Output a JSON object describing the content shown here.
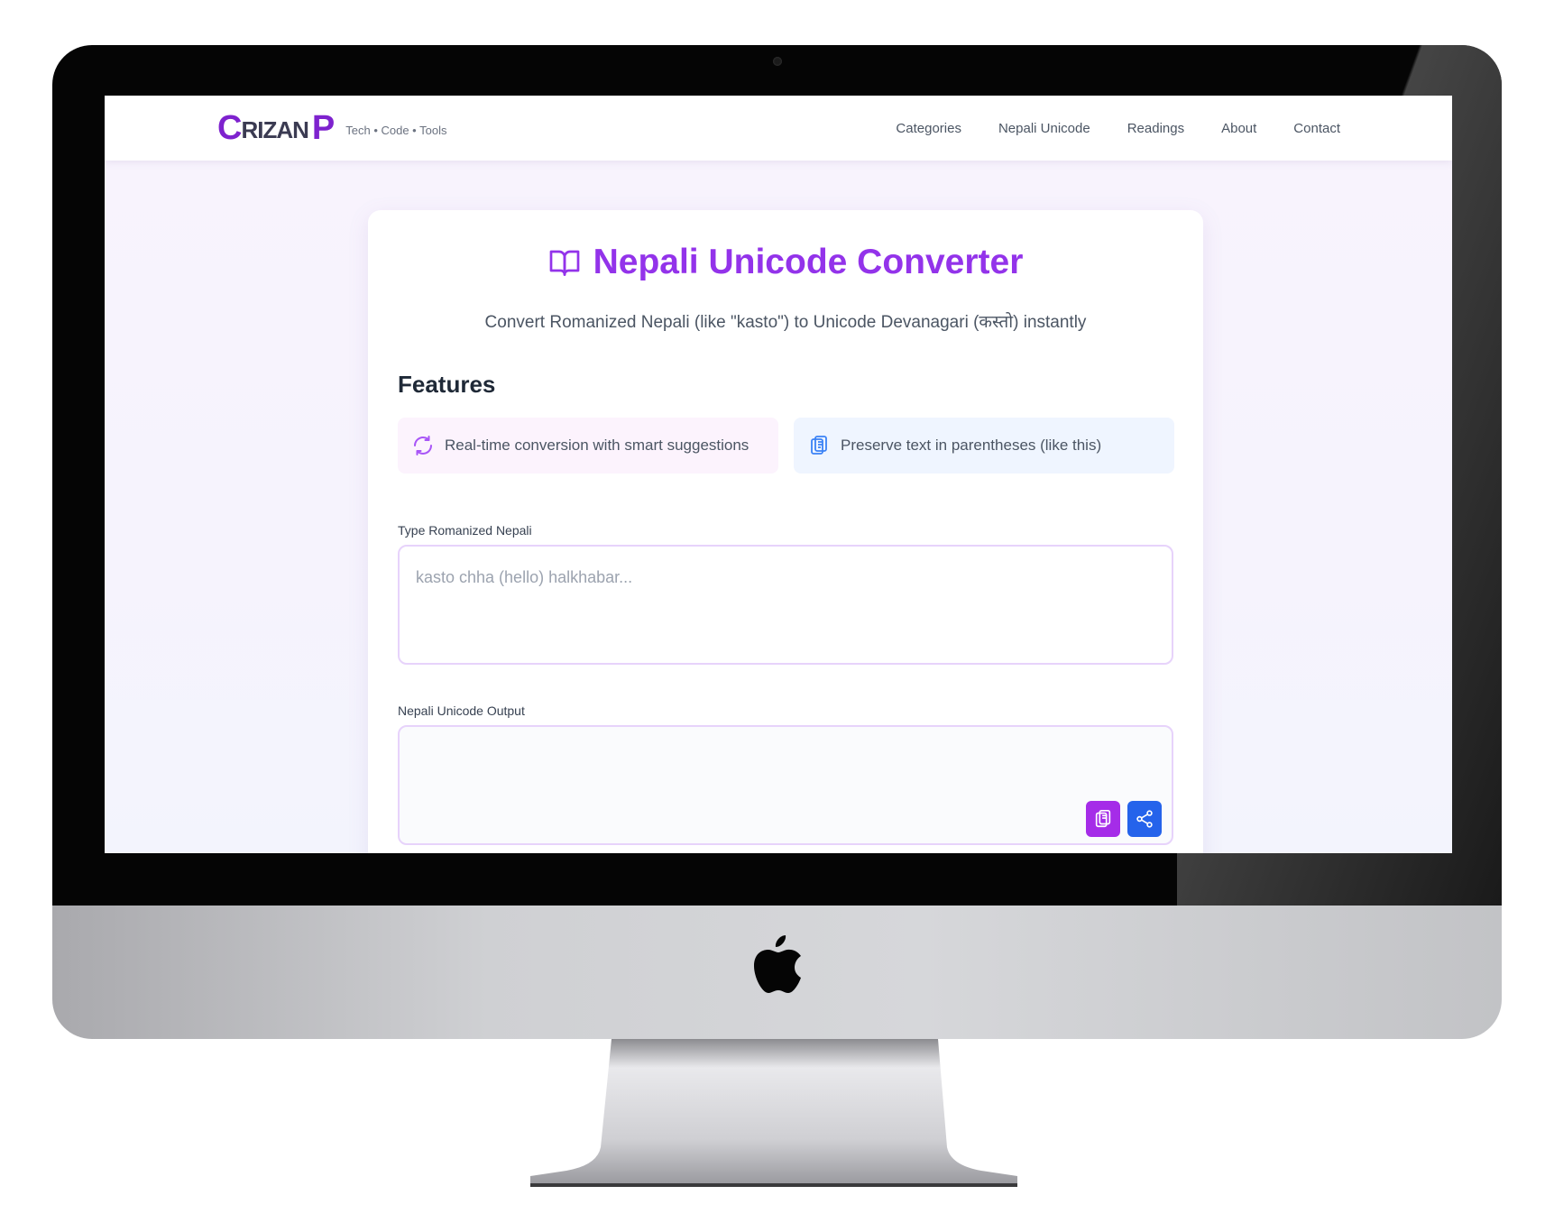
{
  "brand": {
    "letter_c": "C",
    "middle": "RIZAN",
    "letter_p": "P",
    "tagline": "Tech • Code • Tools"
  },
  "nav": [
    "Categories",
    "Nepali Unicode",
    "Readings",
    "About",
    "Contact"
  ],
  "page": {
    "title": "Nepali Unicode Converter",
    "subtitle": "Convert Romanized Nepali (like \"kasto\") to Unicode Devanagari (कस्तो) instantly",
    "features_heading": "Features",
    "features": [
      {
        "icon": "refresh-icon",
        "text": "Real-time conversion with smart suggestions"
      },
      {
        "icon": "clipboard-icon",
        "text": "Preserve text in parentheses (like this)"
      }
    ],
    "input_label": "Type Romanized Nepali",
    "input_placeholder": "kasto chha (hello) halkhabar...",
    "output_label": "Nepali Unicode Output",
    "output_value": ""
  },
  "colors": {
    "accent": "#9333ea",
    "brand": "#7e22ce",
    "copy_button": "#a52ce8",
    "share_button": "#2563eb"
  }
}
